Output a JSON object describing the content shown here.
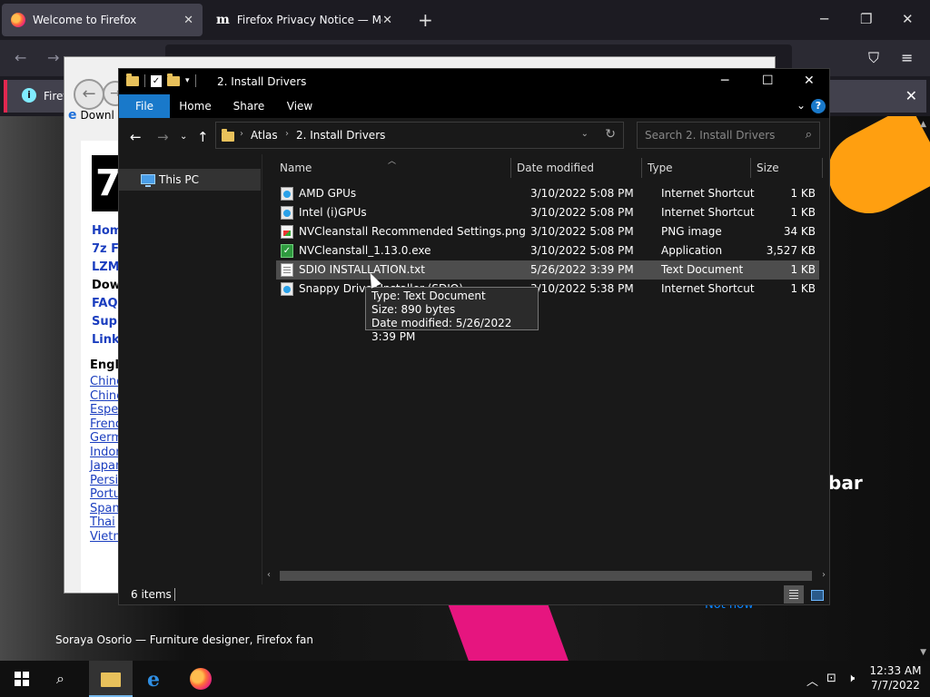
{
  "firefox": {
    "tabs": [
      {
        "title": "Welcome to Firefox",
        "close": "✕"
      },
      {
        "title": "Firefox Privacy Notice — Mozilla",
        "close": "✕"
      }
    ],
    "new_tab": "+",
    "window_controls": {
      "minimize": "─",
      "maximize": "❐",
      "close": "✕"
    },
    "nav": {
      "back": "←",
      "forward": "→",
      "pocket": "⛉",
      "menu": "≡"
    },
    "notification": {
      "text": "Firefox",
      "close": "✕"
    },
    "page": {
      "heading_fragment": "bar",
      "not_now": "Not now",
      "caption": "Soraya Osorio — Furniture designer, Firefox fan"
    }
  },
  "old_window": {
    "address_text": "Downl",
    "logo": "7",
    "nav_links": [
      "Home",
      "7z F",
      "LZM",
      "Dow",
      "FAQ",
      "Supp",
      "Link"
    ],
    "languages_title": "Engl",
    "languages": [
      "Chine",
      "Chine",
      "Espe",
      "Frenc",
      "Germ",
      "Indor",
      "Japan",
      "Persi",
      "Portu",
      "Span",
      "Thai",
      "Vietn"
    ]
  },
  "explorer": {
    "title": "2. Install Drivers",
    "window_controls": {
      "minimize": "─",
      "maximize": "☐",
      "close": "✕"
    },
    "ribbon_tabs": [
      "File",
      "Home",
      "Share",
      "View"
    ],
    "help": "?",
    "breadcrumb": [
      "Atlas",
      "2. Install Drivers"
    ],
    "search_placeholder": "Search 2. Install Drivers",
    "nav_pane": {
      "this_pc": "This PC"
    },
    "columns": [
      "Name",
      "Date modified",
      "Type",
      "Size"
    ],
    "files": [
      {
        "name": "AMD GPUs",
        "date": "3/10/2022 5:08 PM",
        "type": "Internet Shortcut",
        "size": "1 KB",
        "icon": "url"
      },
      {
        "name": "Intel (i)GPUs",
        "date": "3/10/2022 5:08 PM",
        "type": "Internet Shortcut",
        "size": "1 KB",
        "icon": "url"
      },
      {
        "name": "NVCleanstall Recommended Settings.png",
        "date": "3/10/2022 5:08 PM",
        "type": "PNG image",
        "size": "34 KB",
        "icon": "png"
      },
      {
        "name": "NVCleanstall_1.13.0.exe",
        "date": "3/10/2022 5:08 PM",
        "type": "Application",
        "size": "3,527 KB",
        "icon": "exe"
      },
      {
        "name": "SDIO INSTALLATION.txt",
        "date": "5/26/2022 3:39 PM",
        "type": "Text Document",
        "size": "1 KB",
        "icon": "txt"
      },
      {
        "name": "Snappy Driver Installer (SDIO)",
        "date": "3/10/2022 5:38 PM",
        "type": "Internet Shortcut",
        "size": "1 KB",
        "icon": "url"
      }
    ],
    "hover_index": 4,
    "tooltip": [
      "Type: Text Document",
      "Size: 890 bytes",
      "Date modified: 5/26/2022 3:39 PM"
    ],
    "status": {
      "item_count": "6 items"
    }
  },
  "taskbar": {
    "time": "12:33 AM",
    "date": "7/7/2022",
    "ie_glyph": "e"
  }
}
